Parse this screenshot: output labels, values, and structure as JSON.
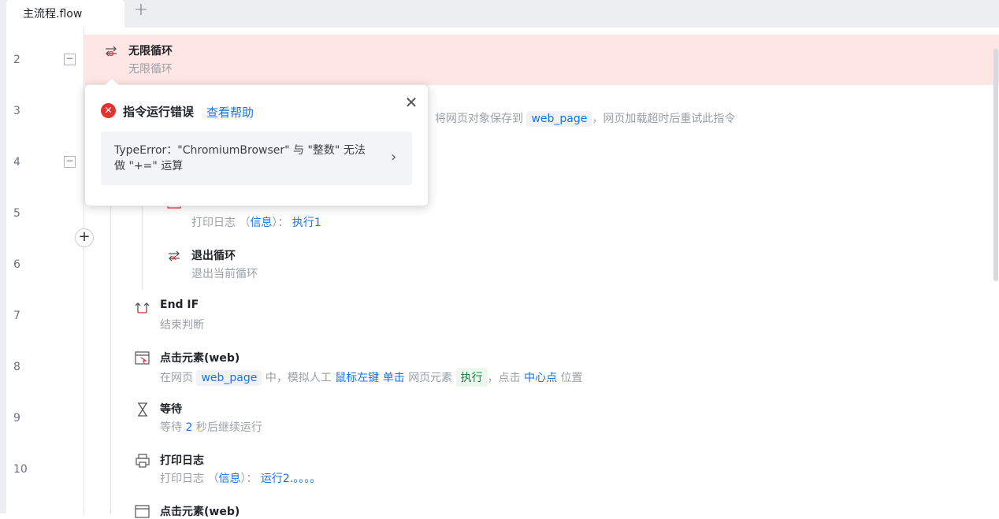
{
  "tabs": {
    "active_tab": "主流程.flow",
    "add_symbol": "+"
  },
  "line_numbers": [
    "2",
    "3",
    "4",
    "5",
    "6",
    "7",
    "8",
    "9",
    "10"
  ],
  "collapse_symbol": "−",
  "add_step_symbol": "+",
  "nodes": {
    "infinite_loop": {
      "title": "无限循环",
      "desc": "无限循环"
    },
    "open_web": {
      "desc_part1": "将网页对象保存到",
      "var": "web_page",
      "desc_part2": "，网页加载超时后重试此指令"
    },
    "print_log_1": {
      "desc_prefix": "打印日志 （",
      "level": "信息",
      "desc_mid": "）：",
      "message": "执行1"
    },
    "exit_loop": {
      "title": "退出循环",
      "desc": "退出当前循环"
    },
    "end_if": {
      "title": "End IF",
      "desc": "结束判断"
    },
    "click_element": {
      "title": "点击元素(web)",
      "desc_prefix": "在网页",
      "var": "web_page",
      "desc_mid": "中，模拟人工",
      "mouse": "鼠标左键",
      "click_type": "单击",
      "desc_mid2": "网页元素",
      "element": "执行",
      "desc_mid3": "，点击",
      "position": "中心点",
      "desc_suffix": "位置"
    },
    "wait": {
      "title": "等待",
      "desc_prefix": "等待",
      "seconds": "2",
      "desc_suffix": "秒后继续运行"
    },
    "print_log_2": {
      "title": "打印日志",
      "desc_prefix": "打印日志 （",
      "level": "信息",
      "desc_mid": "）：",
      "message": "运行2.。。。。"
    },
    "click_element_2": {
      "title": "点击元素(web)"
    }
  },
  "error_popup": {
    "title": "指令运行错误",
    "help_link": "查看帮助",
    "close_symbol": "✕",
    "message": "TypeError：\"ChromiumBrowser\" 与 \"整数\" 无法做 \"+=\" 运算",
    "arrow": "›"
  },
  "colors": {
    "error_row_bg": "#fde6e4",
    "accent": "#1a73e8",
    "error_red": "#e5322d"
  }
}
